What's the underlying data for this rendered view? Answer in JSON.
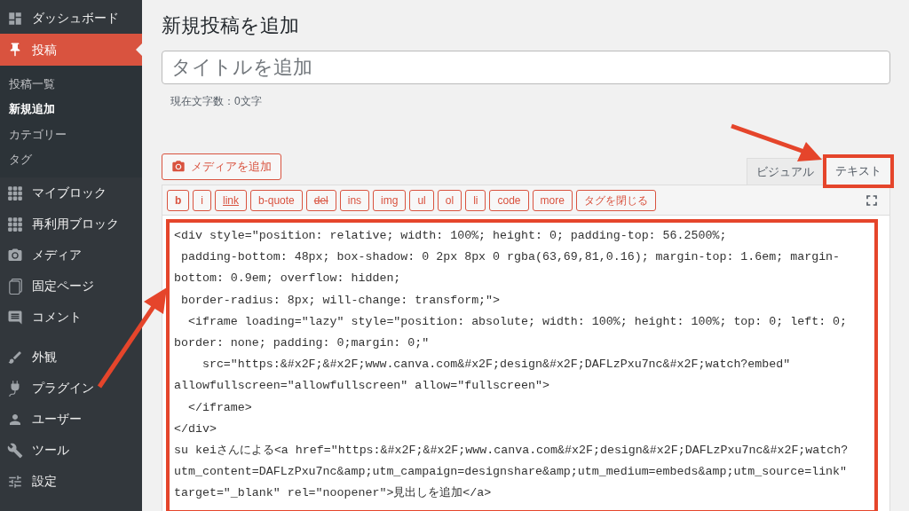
{
  "sidebar": {
    "items": [
      {
        "label": "ダッシュボード",
        "selected": false
      },
      {
        "label": "投稿",
        "selected": true,
        "children": [
          {
            "label": "投稿一覧",
            "selected": false
          },
          {
            "label": "新規追加",
            "selected": true
          },
          {
            "label": "カテゴリー",
            "selected": false
          },
          {
            "label": "タグ",
            "selected": false
          }
        ]
      },
      {
        "label": "マイブロック",
        "selected": false
      },
      {
        "label": "再利用ブロック",
        "selected": false
      },
      {
        "label": "メディア",
        "selected": false
      },
      {
        "label": "固定ページ",
        "selected": false
      },
      {
        "label": "コメント",
        "selected": false
      },
      {
        "label": "外観",
        "selected": false
      },
      {
        "label": "プラグイン",
        "selected": false
      },
      {
        "label": "ユーザー",
        "selected": false
      },
      {
        "label": "ツール",
        "selected": false
      },
      {
        "label": "設定",
        "selected": false
      }
    ]
  },
  "page_title": "新規投稿を追加",
  "title_field": {
    "placeholder": "タイトルを追加"
  },
  "char_count": "現在文字数：0文字",
  "media_button": "メディアを追加",
  "editor_tabs": [
    {
      "label": "ビジュアル",
      "selected": false,
      "highlighted": false
    },
    {
      "label": "テキスト",
      "selected": true,
      "highlighted": true
    }
  ],
  "quicktags": [
    {
      "label": "b",
      "kind": "bold"
    },
    {
      "label": "i",
      "kind": "plain"
    },
    {
      "label": "link",
      "kind": "underline"
    },
    {
      "label": "b-quote",
      "kind": "plain"
    },
    {
      "label": "del",
      "kind": "strike"
    },
    {
      "label": "ins",
      "kind": "plain"
    },
    {
      "label": "img",
      "kind": "plain"
    },
    {
      "label": "ul",
      "kind": "plain"
    },
    {
      "label": "ol",
      "kind": "plain"
    },
    {
      "label": "li",
      "kind": "plain"
    },
    {
      "label": "code",
      "kind": "plain"
    },
    {
      "label": "more",
      "kind": "plain"
    },
    {
      "label": "タグを閉じる",
      "kind": "plain"
    }
  ],
  "editor": {
    "highlighted": true,
    "lines": [
      "<div style=\"position: relative; width: 100%; height: 0; padding-top: 56.2500%;",
      " padding-bottom: 48px; box-shadow: 0 2px 8px 0 rgba(63,69,81,0.16); margin-top: 1.6em; margin-",
      "bottom: 0.9em; overflow: hidden;",
      " border-radius: 8px; will-change: transform;\">",
      "  <iframe loading=\"lazy\" style=\"position: absolute; width: 100%; height: 100%; top: 0; left: 0;",
      "border: none; padding: 0;margin: 0;\"",
      "    src=\"https:&#x2F;&#x2F;www.canva.com&#x2F;design&#x2F;DAFLzPxu7nc&#x2F;watch?embed\"",
      "allowfullscreen=\"allowfullscreen\" allow=\"fullscreen\">",
      "  </iframe>",
      "</div>",
      "su keiさんによる<a href=\"https:&#x2F;&#x2F;www.canva.com&#x2F;design&#x2F;DAFLzPxu7nc&#x2F;watch?",
      "utm_content=DAFLzPxu7nc&amp;utm_campaign=designshare&amp;utm_medium=embeds&amp;utm_source=link\"",
      "target=\"_blank\" rel=\"noopener\">見出しを追加</a>"
    ]
  }
}
